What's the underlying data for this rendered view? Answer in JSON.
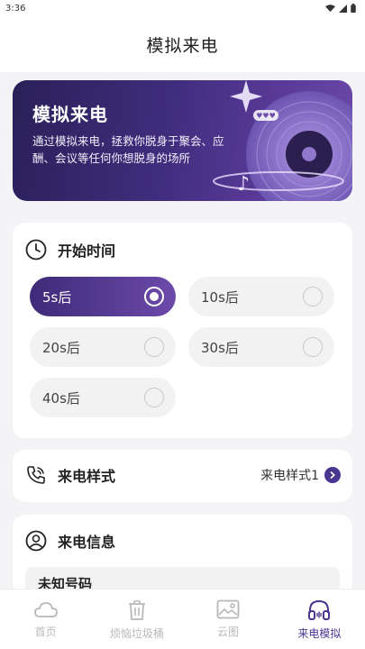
{
  "status_bar": {
    "time": "3:36"
  },
  "header": {
    "title": "模拟来电"
  },
  "banner": {
    "title": "模拟来电",
    "description": "通过模拟来电，拯救你脱身于聚会、应酬、会议等任何你想脱身的场所",
    "bubble_text": "♥♥♥"
  },
  "start_time": {
    "label": "开始时间",
    "options": [
      {
        "label": "5s后",
        "selected": true
      },
      {
        "label": "10s后",
        "selected": false
      },
      {
        "label": "20s后",
        "selected": false
      },
      {
        "label": "30s后",
        "selected": false
      },
      {
        "label": "40s后",
        "selected": false
      }
    ]
  },
  "call_style": {
    "label": "来电样式",
    "value": "来电样式1"
  },
  "call_info": {
    "label": "来电信息",
    "name_value": "未知号码"
  },
  "tabbar": {
    "items": [
      {
        "label": "首页",
        "icon": "cloud-icon",
        "active": false
      },
      {
        "label": "烦恼垃圾桶",
        "icon": "trash-icon",
        "active": false
      },
      {
        "label": "云图",
        "icon": "image-icon",
        "active": false
      },
      {
        "label": "来电模拟",
        "icon": "headphones-icon",
        "active": true
      }
    ]
  },
  "colors": {
    "accent": "#4a3590",
    "banner_start": "#2a2058",
    "banner_end": "#6b4aa8",
    "background": "#f4f4f6"
  }
}
